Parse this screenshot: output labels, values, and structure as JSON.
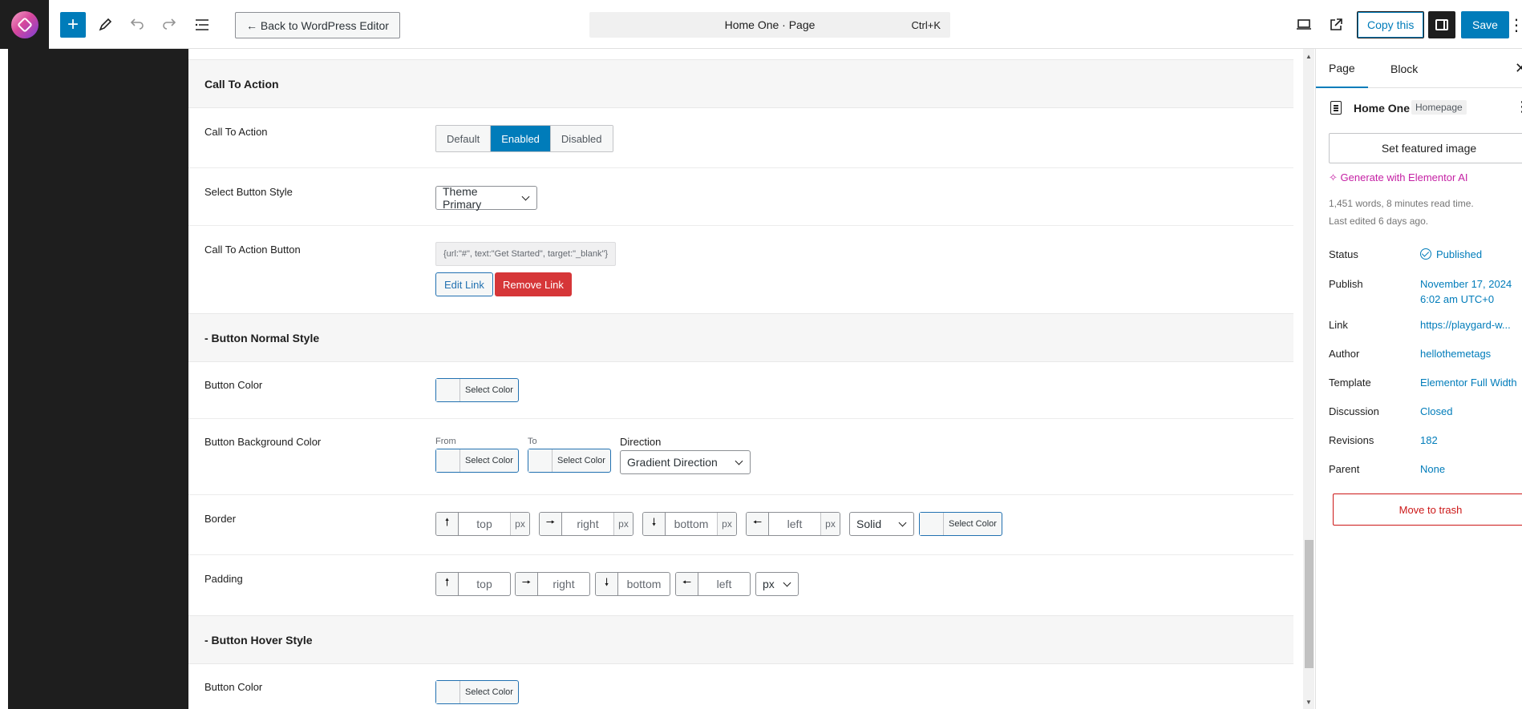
{
  "topbar": {
    "back_label": "← Back to WordPress Editor",
    "doc_title": "Home One · Page",
    "shortcut": "Ctrl+K",
    "copy_label": "Copy this",
    "save_label": "Save"
  },
  "sections": {
    "cta_title": "Call To Action",
    "normal_title": "- Button Normal Style",
    "hover_title": "- Button Hover Style"
  },
  "cta": {
    "label": "Call To Action",
    "options": [
      "Default",
      "Enabled",
      "Disabled"
    ],
    "active": "Enabled",
    "style_label": "Select Button Style",
    "style_value": "Theme Primary",
    "button_label": "Call To Action Button",
    "button_value": "{url:\"#\", text:\"Get Started\", target:\"_blank\"}",
    "edit_link": "Edit Link",
    "remove_link": "Remove Link"
  },
  "normal": {
    "color_label": "Button Color",
    "bg_label": "Button Background Color",
    "from_label": "From",
    "to_label": "To",
    "direction_label": "Direction",
    "direction_value": "Gradient Direction",
    "border_label": "Border",
    "padding_label": "Padding",
    "select_color": "Select Color",
    "top": "top",
    "right": "right",
    "bottom": "bottom",
    "left": "left",
    "unit": "px",
    "border_style": "Solid",
    "padding_unit": "px"
  },
  "hover": {
    "color_label": "Button Color",
    "select_color": "Select Color"
  },
  "sidebar": {
    "tab_page": "Page",
    "tab_block": "Block",
    "title": "Home One",
    "badge": "Homepage",
    "featured": "Set featured image",
    "ai": "Generate with Elementor AI",
    "words": "1,451 words, 8 minutes read time.",
    "edited": "Last edited 6 days ago.",
    "status_key": "Status",
    "status_val": "Published",
    "publish_key": "Publish",
    "publish_val1": "November 17, 2024",
    "publish_val2": "6:02 am UTC+0",
    "link_key": "Link",
    "link_val": "https://playgard-w...",
    "author_key": "Author",
    "author_val": "hellothemetags",
    "template_key": "Template",
    "template_val": "Elementor Full Width",
    "discussion_key": "Discussion",
    "discussion_val": "Closed",
    "revisions_key": "Revisions",
    "revisions_val": "182",
    "parent_key": "Parent",
    "parent_val": "None",
    "trash": "Move to trash"
  },
  "colors": {
    "accent": "#007cba",
    "danger": "#d63638",
    "ai": "#c521a4"
  }
}
